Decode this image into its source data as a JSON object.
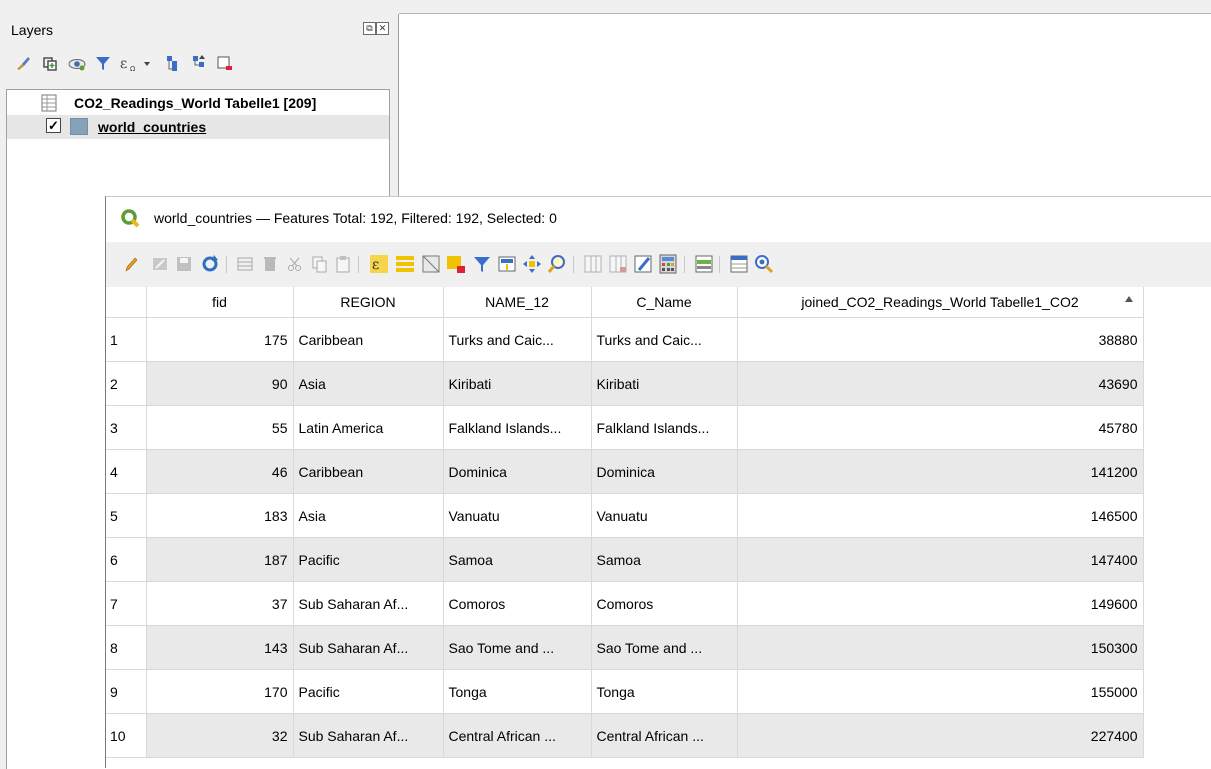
{
  "layers_panel": {
    "title": "Layers",
    "dock_float": "⧉",
    "dock_close": "✕",
    "toolbar_icons": [
      "style-manager-icon",
      "add-group-icon",
      "visibility-icon",
      "filter-legend-icon",
      "filter-expression-icon",
      "dropdown-arrow-icon",
      "expand-all-icon",
      "collapse-all-icon",
      "remove-layer-icon"
    ],
    "layers": [
      {
        "name": "CO2_Readings_World Tabelle1 [209]",
        "checked": null,
        "type": "table"
      },
      {
        "name": "world_countries",
        "checked": "✓",
        "type": "polygon"
      }
    ]
  },
  "attribute_table": {
    "title": "world_countries — Features Total: 192, Filtered: 192, Selected: 0",
    "columns": [
      "fid",
      "REGION",
      "NAME_12",
      "C_Name",
      "joined_CO2_Readings_World Tabelle1_CO2"
    ],
    "sort_column": "joined_CO2_Readings_World Tabelle1_CO2",
    "sort_direction": "ascending",
    "rows": [
      {
        "n": "1",
        "fid": "175",
        "region": "Caribbean",
        "name12": "Turks and Caic...",
        "cname": "Turks and Caic...",
        "co2": "38880"
      },
      {
        "n": "2",
        "fid": "90",
        "region": "Asia",
        "name12": "Kiribati",
        "cname": "Kiribati",
        "co2": "43690"
      },
      {
        "n": "3",
        "fid": "55",
        "region": "Latin America",
        "name12": "Falkland Islands...",
        "cname": "Falkland Islands...",
        "co2": "45780"
      },
      {
        "n": "4",
        "fid": "46",
        "region": "Caribbean",
        "name12": "Dominica",
        "cname": "Dominica",
        "co2": "141200"
      },
      {
        "n": "5",
        "fid": "183",
        "region": "Asia",
        "name12": "Vanuatu",
        "cname": "Vanuatu",
        "co2": "146500"
      },
      {
        "n": "6",
        "fid": "187",
        "region": "Pacific",
        "name12": "Samoa",
        "cname": "Samoa",
        "co2": "147400"
      },
      {
        "n": "7",
        "fid": "37",
        "region": "Sub Saharan Af...",
        "name12": "Comoros",
        "cname": "Comoros",
        "co2": "149600"
      },
      {
        "n": "8",
        "fid": "143",
        "region": "Sub Saharan Af...",
        "name12": "Sao Tome and ...",
        "cname": "Sao Tome and ...",
        "co2": "150300"
      },
      {
        "n": "9",
        "fid": "170",
        "region": "Pacific",
        "name12": "Tonga",
        "cname": "Tonga",
        "co2": "155000"
      },
      {
        "n": "10",
        "fid": "32",
        "region": "Sub Saharan Af...",
        "name12": "Central African ...",
        "cname": "Central African ...",
        "co2": "227400"
      }
    ]
  },
  "colors": {
    "qgis_green": "#5b9f32",
    "alt_row": "#e9e9e9",
    "selection": "#e6e6e6"
  }
}
